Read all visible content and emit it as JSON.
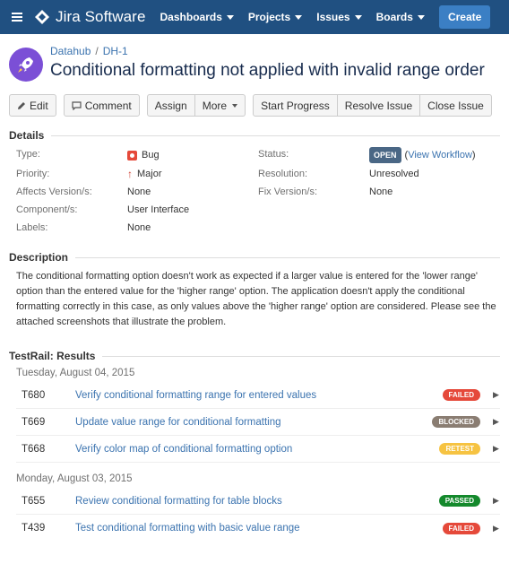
{
  "nav": {
    "brand": "Jira Software",
    "items": [
      {
        "label": "Dashboards"
      },
      {
        "label": "Projects"
      },
      {
        "label": "Issues"
      },
      {
        "label": "Boards"
      }
    ],
    "create_label": "Create",
    "colors": {
      "bar": "#205081",
      "create": "#3b7fc4"
    }
  },
  "issue": {
    "breadcrumb_project": "Datahub",
    "breadcrumb_sep": "/",
    "breadcrumb_key": "DH-1",
    "title": "Conditional formatting not applied with invalid range order"
  },
  "toolbar": {
    "edit": "Edit",
    "comment": "Comment",
    "assign": "Assign",
    "more": "More",
    "start_progress": "Start Progress",
    "resolve": "Resolve Issue",
    "close": "Close Issue"
  },
  "details": {
    "heading": "Details",
    "type_label": "Type:",
    "type_value": "Bug",
    "priority_label": "Priority:",
    "priority_value": "Major",
    "affects_label": "Affects Version/s:",
    "affects_value": "None",
    "components_label": "Component/s:",
    "components_value": "User Interface",
    "labels_label": "Labels:",
    "labels_value": "None",
    "status_label": "Status:",
    "status_value": "OPEN",
    "view_workflow": "View Workflow",
    "resolution_label": "Resolution:",
    "resolution_value": "Unresolved",
    "fix_label": "Fix Version/s:",
    "fix_value": "None"
  },
  "description": {
    "heading": "Description",
    "text": "The conditional formatting option doesn't work as expected if a larger value is entered for the 'lower range' option than the entered value for the 'higher range' option. The application doesn't apply the conditional formatting correctly in this case, as only values above the 'higher range' option are considered. Please see the attached screenshots that illustrate the problem."
  },
  "testrail": {
    "heading": "TestRail: Results",
    "groups": [
      {
        "date": "Tuesday, August 04, 2015",
        "tests": [
          {
            "id": "T680",
            "name": "Verify conditional formatting range for entered values",
            "status": "FAILED",
            "color": "#e5493a"
          },
          {
            "id": "T669",
            "name": "Update value range for conditional formatting",
            "status": "BLOCKED",
            "color": "#8a7d72"
          },
          {
            "id": "T668",
            "name": "Verify color map of conditional formatting option",
            "status": "RETEST",
            "color": "#f6c342"
          }
        ]
      },
      {
        "date": "Monday, August 03, 2015",
        "tests": [
          {
            "id": "T655",
            "name": "Review conditional formatting for table blocks",
            "status": "PASSED",
            "color": "#14892c"
          },
          {
            "id": "T439",
            "name": "Test conditional formatting with basic value range",
            "status": "FAILED",
            "color": "#e5493a"
          }
        ]
      }
    ]
  }
}
